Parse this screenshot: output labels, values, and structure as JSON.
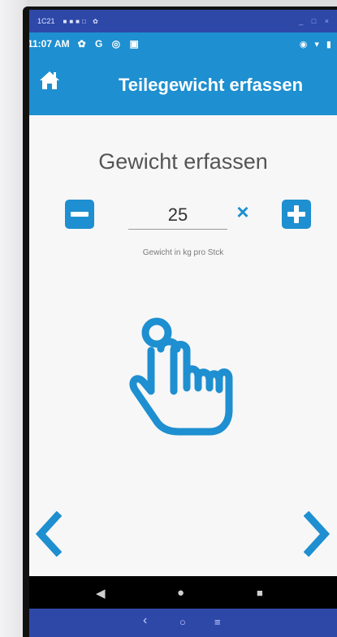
{
  "emulator": {
    "top_title": "1C21",
    "window_controls": "_ □ ×"
  },
  "status_bar": {
    "time": "11:07 AM",
    "left_icons": "✿ G ◎ ▣",
    "right_icons": "◉ ▾ ▮"
  },
  "app_bar": {
    "title": "Teilegewicht erfassen",
    "home_icon": "home-icon",
    "color": "#1e8fd0"
  },
  "main": {
    "heading": "Gewicht erfassen",
    "weight_value": "25",
    "clear_symbol": "×",
    "hint": "Gewicht in kg pro Stck"
  },
  "icons": {
    "minus": "minus-icon",
    "plus": "plus-icon",
    "hand": "hand-pointer-icon",
    "back_arrow": "chevron-left-icon",
    "forward_arrow": "chevron-right-icon"
  },
  "android_nav": {
    "back": "◀",
    "home": "●",
    "recents": "■"
  },
  "emulator_nav": {
    "back": "‹",
    "home": "○",
    "menu": "≡"
  }
}
